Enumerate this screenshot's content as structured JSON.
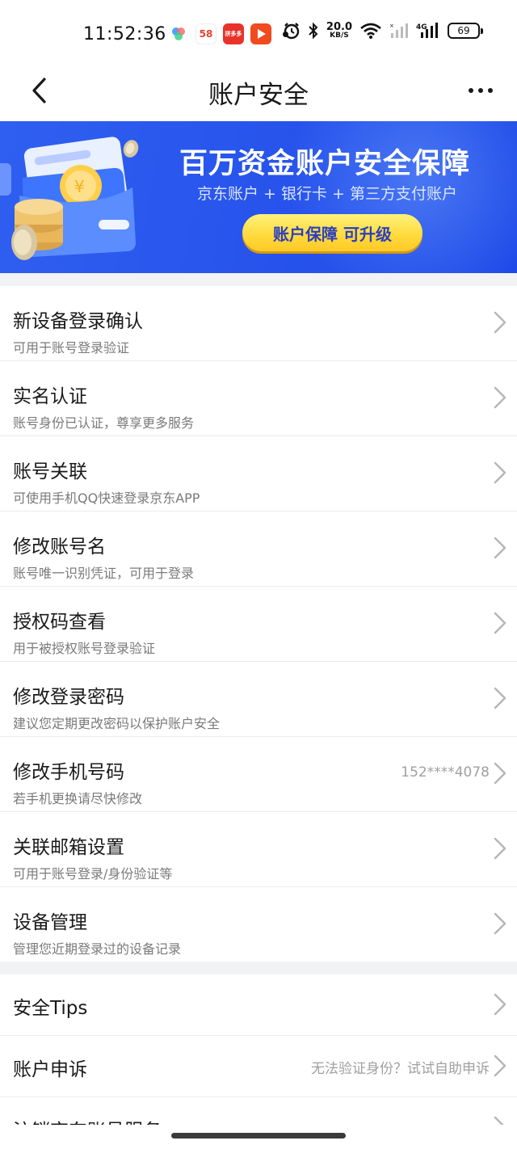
{
  "status_bar": {
    "time": "11:52:36",
    "app_icons": [
      "pinwheel-app-icon",
      "58-app-icon",
      "pinduoduo-app-icon",
      "video-app-icon"
    ],
    "app_icon_labels": {
      "a2": "58",
      "a3": "拼多多"
    },
    "net_speed_value": "20.0",
    "net_speed_unit": "KB/S",
    "network_type": "4G",
    "battery": "69"
  },
  "header": {
    "title": "账户安全"
  },
  "banner": {
    "title": "百万资金账户安全保障",
    "subtitle": "京东账户 + 银行卡 + 第三方支付账户",
    "button_label": "账户保障 可升级",
    "colors": {
      "background": "#2753ec",
      "button": "#ffd93a",
      "button_text": "#2a3fbf"
    }
  },
  "settings": [
    {
      "title": "新设备登录确认",
      "subtitle": "可用于账号登录验证",
      "value": ""
    },
    {
      "title": "实名认证",
      "subtitle": "账号身份已认证，尊享更多服务",
      "value": ""
    },
    {
      "title": "账号关联",
      "subtitle": "可使用手机QQ快速登录京东APP",
      "value": ""
    },
    {
      "title": "修改账号名",
      "subtitle": "账号唯一识别凭证，可用于登录",
      "value": ""
    },
    {
      "title": "授权码查看",
      "subtitle": "用于被授权账号登录验证",
      "value": ""
    },
    {
      "title": "修改登录密码",
      "subtitle": "建议您定期更改密码以保护账户安全",
      "value": ""
    },
    {
      "title": "修改手机号码",
      "subtitle": "若手机更换请尽快修改",
      "value": "152****4078"
    },
    {
      "title": "关联邮箱设置",
      "subtitle": "可用于账号登录/身份验证等",
      "value": ""
    },
    {
      "title": "设备管理",
      "subtitle": "管理您近期登录过的设备记录",
      "value": ""
    }
  ],
  "more": [
    {
      "title": "安全Tips",
      "value": ""
    },
    {
      "title": "账户申诉",
      "value": "无法验证身份？试试自助申诉"
    },
    {
      "title": "注销京东账号服务",
      "value": ""
    }
  ]
}
